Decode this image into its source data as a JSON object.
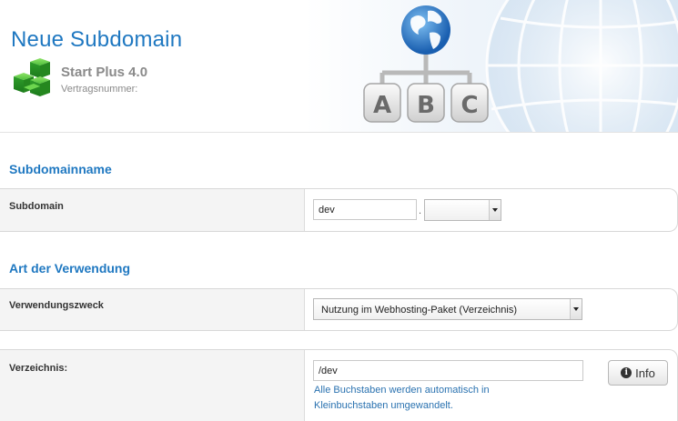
{
  "header": {
    "title": "Neue Subdomain",
    "product_name": "Start Plus 4.0",
    "contract_label": "Vertragsnummer:",
    "hero_letters": [
      "A",
      "B",
      "C"
    ]
  },
  "sections": {
    "subdomain_name": {
      "title": "Subdomainname",
      "subdomain_label": "Subdomain",
      "subdomain_value": "dev",
      "separator": ".",
      "domain_select_value": ""
    },
    "usage": {
      "title": "Art der Verwendung",
      "purpose_label": "Verwendungszweck",
      "purpose_value": "Nutzung im Webhosting-Paket (Verzeichnis)",
      "directory_label": "Verzeichnis:",
      "directory_value": "/dev",
      "directory_hint": "Alle Buchstaben werden automatisch in Kleinbuchstaben umgewandelt.",
      "info_button_label": "Info"
    }
  },
  "colors": {
    "accent": "#1f78c1",
    "label_bg": "#f4f4f4",
    "product_green": "#3cb43c"
  }
}
